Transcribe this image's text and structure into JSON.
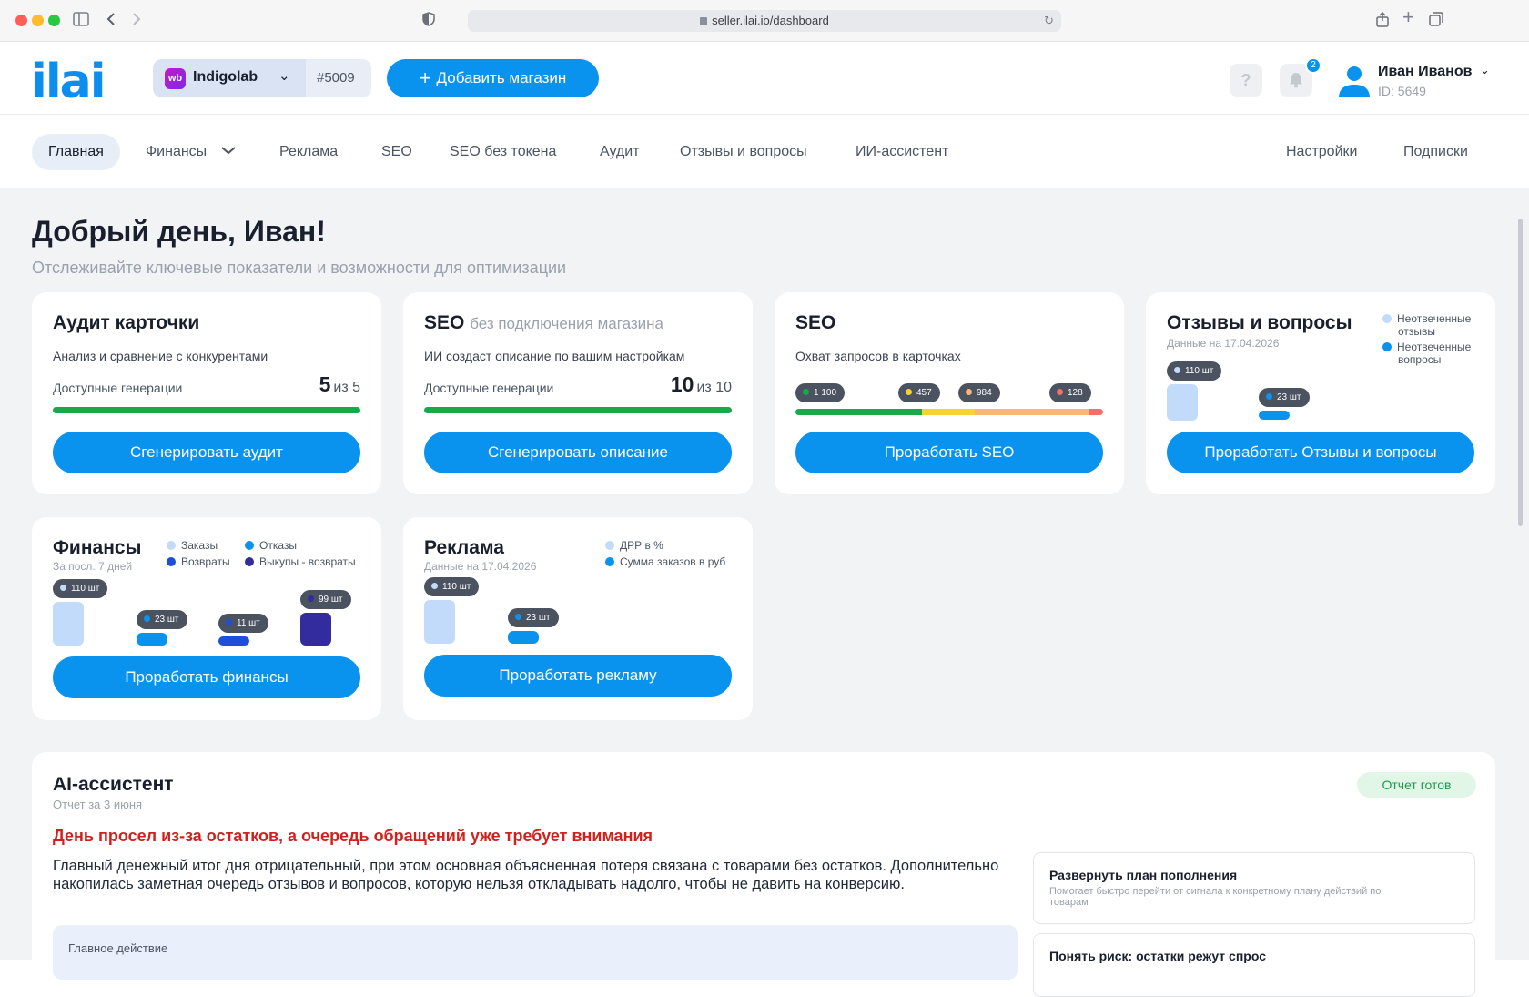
{
  "browser": {
    "url": "seller.ilai.io/dashboard",
    "traffic_lights": [
      "#ff5f57",
      "#febc2e",
      "#28c840"
    ]
  },
  "header": {
    "logo": "ilai",
    "store": {
      "badge": "wb",
      "name": "Indigolab",
      "id": "#5009"
    },
    "add_store_label": "Добавить магазин",
    "help_label": "?",
    "notification_count": "2",
    "user": {
      "name": "Иван Иванов",
      "id": "ID: 5649"
    }
  },
  "nav": {
    "items": [
      "Главная",
      "Финансы",
      "Реклама",
      "SEO",
      "SEO без токена",
      "Аудит",
      "Отзывы и вопросы",
      "ИИ-ассистент"
    ],
    "right": [
      "Настройки",
      "Подписки"
    ]
  },
  "page": {
    "title": "Добрый день, Иван!",
    "subtitle": "Отслеживайте ключевые показатели и возможности для оптимизации"
  },
  "cards": {
    "audit": {
      "title": "Аудит карточки",
      "desc": "Анализ и сравнение с конкурентами",
      "gen_label": "Доступные генерации",
      "gen_value": "5",
      "gen_total": "из 5",
      "button": "Сгенерировать аудит"
    },
    "seo_no_token": {
      "title": "SEO",
      "title_muted": "без подключения магазина",
      "desc": "ИИ создаст описание по вашим настройкам",
      "gen_label": "Доступные генерации",
      "gen_value": "10",
      "gen_total": "из 10",
      "button": "Сгенерировать описание"
    },
    "seo": {
      "title": "SEO",
      "desc": "Охват запросов в карточках",
      "segments": [
        {
          "label": "1 100",
          "value": 1100,
          "color": "#1ba84a"
        },
        {
          "label": "457",
          "value": 457,
          "color": "#f7d232"
        },
        {
          "label": "984",
          "value": 984,
          "color": "#fbb577"
        },
        {
          "label": "128",
          "value": 128,
          "color": "#f2706b"
        }
      ],
      "button": "Проработать SEO"
    },
    "reviews": {
      "title": "Отзывы и вопросы",
      "date": "Данные на 17.04.2026",
      "legend": [
        {
          "label": "Неотвеченные отзывы",
          "color": "#c2dbfa"
        },
        {
          "label": "Неотвеченные вопросы",
          "color": "#0a93ee"
        }
      ],
      "bars": [
        {
          "label": "110 шт",
          "value": 110,
          "color": "#c2dbfa"
        },
        {
          "label": "23 шт",
          "value": 23,
          "color": "#0a93ee"
        }
      ],
      "button": "Проработать Отзывы и вопросы"
    },
    "finance": {
      "title": "Финансы",
      "date": "За посл. 7 дней",
      "legend": [
        {
          "label": "Заказы",
          "color": "#c2dbfa"
        },
        {
          "label": "Отказы",
          "color": "#0a93ee"
        },
        {
          "label": "Возвраты",
          "color": "#1e4fd8"
        },
        {
          "label": "Выкупы - возвраты",
          "color": "#332c9e"
        }
      ],
      "bars": [
        {
          "label": "110 шт",
          "value": 110,
          "color": "#c2dbfa"
        },
        {
          "label": "23 шт",
          "value": 23,
          "color": "#0a93ee"
        },
        {
          "label": "11 шт",
          "value": 11,
          "color": "#1e4fd8"
        },
        {
          "label": "99 шт",
          "value": 99,
          "color": "#332c9e"
        }
      ],
      "button": "Проработать финансы"
    },
    "ads": {
      "title": "Реклама",
      "date": "Данные на 17.04.2026",
      "legend": [
        {
          "label": "ДРР в %",
          "color": "#c2dbfa"
        },
        {
          "label": "Сумма заказов в руб",
          "color": "#0a93ee"
        }
      ],
      "bars": [
        {
          "label": "110 шт",
          "value": 110,
          "color": "#c2dbfa"
        },
        {
          "label": "23 шт",
          "value": 23,
          "color": "#0a93ee"
        }
      ],
      "button": "Проработать рекламу"
    }
  },
  "ai": {
    "title": "AI-ассистент",
    "date": "Отчет за 3 июня",
    "status": "Отчет готов",
    "headline": "День просел из-за остатков, а очередь обращений уже требует внимания",
    "body": "Главный денежный итог дня отрицательный, при этом основная объясненная потеря связана с товарами без остатков. Дополнительно накопилась заметная очередь отзывов и вопросов, которую нельзя откладывать надолго, чтобы не давить на конверсию.",
    "main_action_label": "Главное действие",
    "actions": [
      {
        "title": "Развернуть план пополнения",
        "desc": "Помогает быстро перейти от сигнала к конкретному плану действий по товарам"
      },
      {
        "title": "Понять риск: остатки режут спрос",
        "desc": ""
      }
    ]
  }
}
